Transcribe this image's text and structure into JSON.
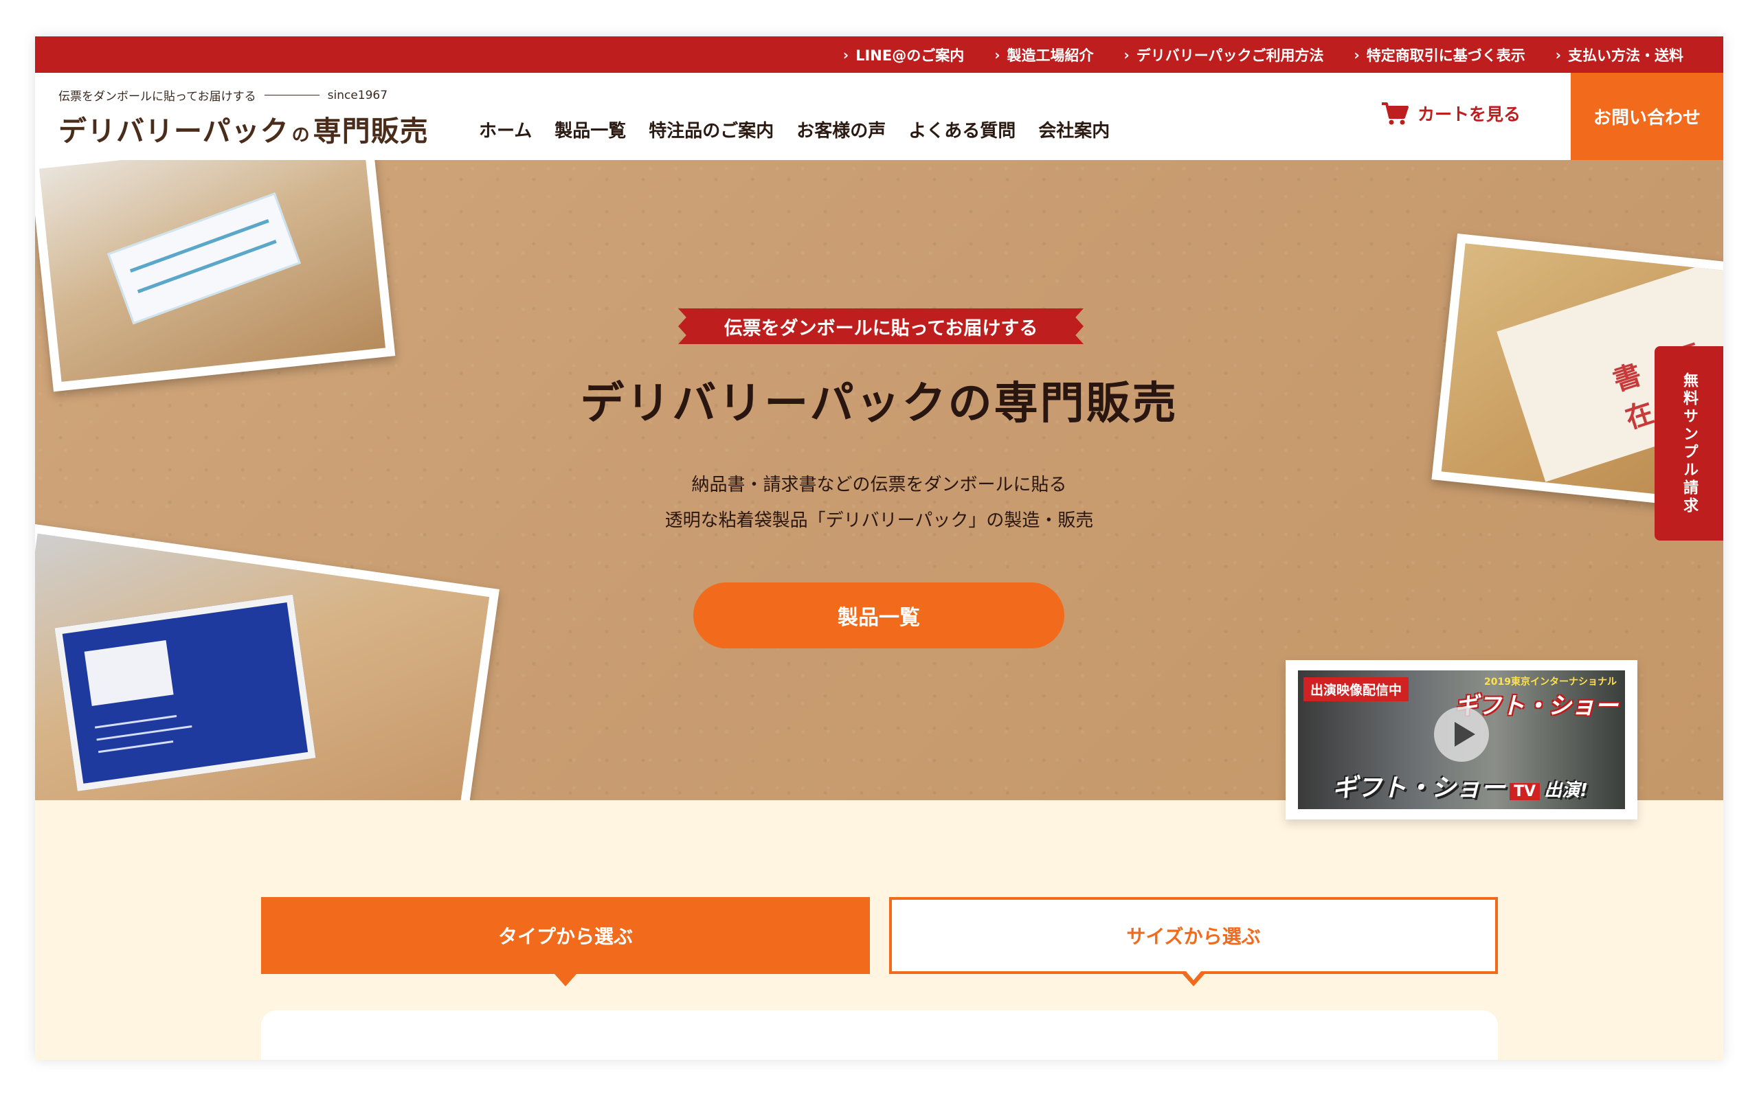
{
  "topbar": {
    "links": [
      {
        "label": "LINE@のご案内"
      },
      {
        "label": "製造工場紹介"
      },
      {
        "label": "デリバリーパックご利用方法"
      },
      {
        "label": "特定商取引に基づく表示"
      },
      {
        "label": "支払い方法・送料"
      }
    ]
  },
  "header": {
    "logo_tagline": "伝票をダンボールに貼ってお届けする",
    "logo_since": "since1967",
    "logo_main": "デリバリーパック",
    "logo_no": "の",
    "logo_suffix": "専門販売",
    "nav": [
      {
        "label": "ホーム"
      },
      {
        "label": "製品一覧"
      },
      {
        "label": "特注品のご案内"
      },
      {
        "label": "お客様の声"
      },
      {
        "label": "よくある質問"
      },
      {
        "label": "会社案内"
      }
    ],
    "cart_label": "カートを見る",
    "contact_label": "お問い合わせ"
  },
  "hero": {
    "ribbon": "伝票をダンボールに貼ってお届けする",
    "title": "デリバリーパックの専門販売",
    "text_line1": "納品書・請求書などの伝票をダンボールに貼る",
    "text_line2": "透明な粘着袋製品「デリバリーパック」の製造・販売",
    "cta_label": "製品一覧",
    "side_tab": "無料サンプル請求",
    "photo_envelope_text": "書 類 在",
    "video": {
      "badge": "出演映像配信中",
      "small": "2019東京インターナショナル",
      "big": "ギフト・ショー",
      "bottom": "ギフト・ショー",
      "tv": "TV",
      "suffix": "出演!"
    }
  },
  "tabs": {
    "type_label": "タイプから選ぶ",
    "size_label": "サイズから選ぶ"
  },
  "colors": {
    "red": "#bf1e1e",
    "orange": "#f26a1b",
    "cream": "#fff5e1"
  }
}
